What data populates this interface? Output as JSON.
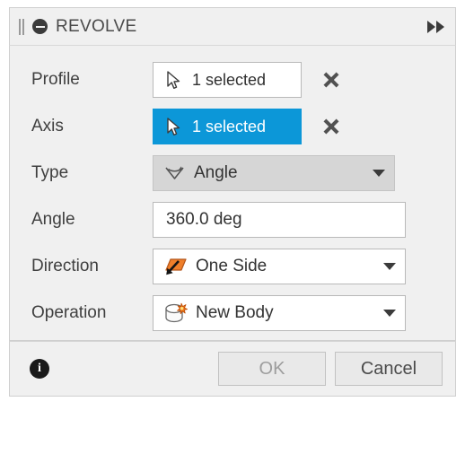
{
  "dialog": {
    "title": "REVOLVE",
    "titlebar": {
      "grip_icon": "drag-grip-icon",
      "collapse_icon": "collapse-circle-icon",
      "forward_icon": "fast-forward-icon"
    }
  },
  "rows": [
    {
      "label": "Profile",
      "type": "selection",
      "value": "1 selected",
      "icon": "selection-cursor-icon",
      "active": false,
      "clear_label": "clear-selection"
    },
    {
      "label": "Axis",
      "type": "selection",
      "value": "1 selected",
      "icon": "selection-cursor-icon",
      "active": true,
      "clear_label": "clear-selection"
    },
    {
      "label": "Type",
      "type": "dropdown",
      "value": "Angle",
      "icon": "angle-arc-icon",
      "style": "grey"
    },
    {
      "label": "Angle",
      "type": "text",
      "value": "360.0 deg",
      "placeholder": "360.0 deg"
    },
    {
      "label": "Direction",
      "type": "dropdown",
      "value": "One Side",
      "icon": "one-side-direction-icon",
      "style": "white"
    },
    {
      "label": "Operation",
      "type": "dropdown",
      "value": "New Body",
      "icon": "new-body-icon",
      "style": "white"
    }
  ],
  "footer": {
    "info_icon": "info-icon",
    "ok_label": "OK",
    "cancel_label": "Cancel"
  },
  "colors": {
    "accent_blue": "#0c97d8",
    "dialog_bg": "#f0f0f0",
    "orange": "#ef7f2a",
    "text": "#3f3f3f"
  }
}
